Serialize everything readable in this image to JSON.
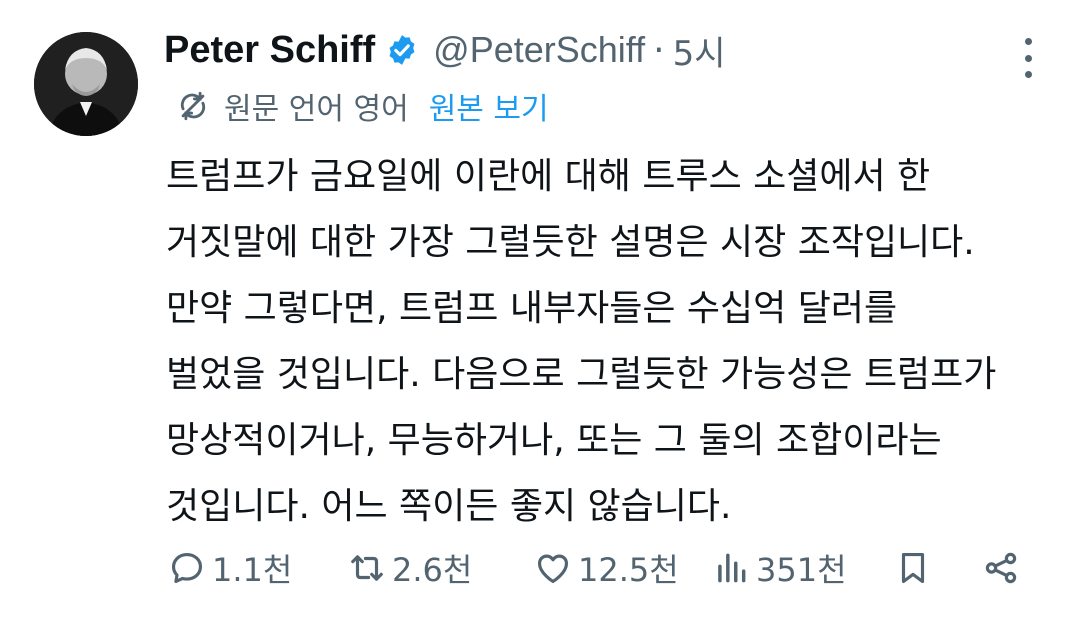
{
  "author": {
    "name": "Peter Schiff",
    "handle": "@PeterSchiff",
    "separator": "·",
    "time": "5시",
    "verified": true,
    "avatar_icon": "profile-photo"
  },
  "translation": {
    "note": "원문 언어 영어",
    "view_original": "원본 보기",
    "link_color": "#1d9bf0"
  },
  "tweet": {
    "lines": [
      "트럼프가 금요일에 이란에 대해 트루스 소셜에서 한",
      "거짓말에 대한 가장 그럴듯한 설명은 시장 조작입니다.",
      "만약 그렇다면, 트럼프 내부자들은 수십억 달러를",
      "벌었을 것입니다. 다음으로 그럴듯한 가능성은 트럼프가",
      "망상적이거나, 무능하거나, 또는 그 둘의 조합이라는",
      "것입니다. 어느 쪽이든 좋지 않습니다."
    ]
  },
  "actions": {
    "replies": "1.1천",
    "reposts": "2.6천",
    "likes": "12.5천",
    "views": "351천"
  },
  "colors": {
    "text": "#0f1419",
    "muted": "#536471",
    "verified": "#1d9bf0"
  }
}
